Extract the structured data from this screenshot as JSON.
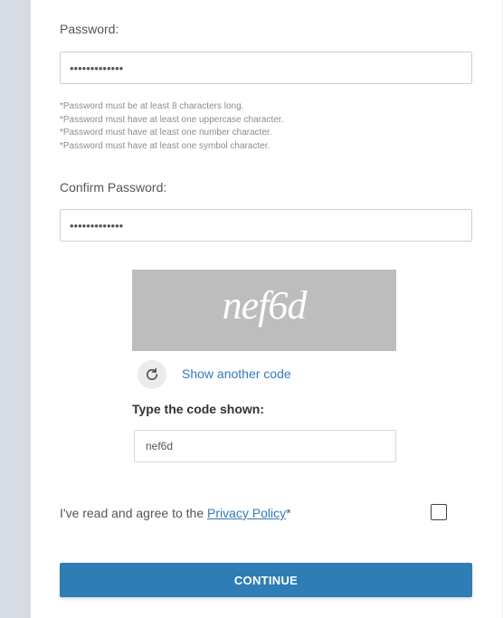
{
  "password": {
    "label": "Password:",
    "value": "•••••••••••••"
  },
  "password_rules": [
    "*Password must be at least 8 characters long.",
    "*Password must have at least one uppercase character.",
    "*Password must have at least one number character.",
    "*Password must have at least one symbol character."
  ],
  "confirm_password": {
    "label": "Confirm Password:",
    "value": "•••••••••••••"
  },
  "captcha": {
    "image_text": "nef6d",
    "refresh_icon": "refresh-icon",
    "another_code_label": "Show another code",
    "type_label": "Type the code shown:",
    "input_value": "nef6d"
  },
  "agreement": {
    "prefix": "I've read and agree to the ",
    "link_text": "Privacy Policy",
    "required_mark": "*"
  },
  "continue_button": {
    "label": "CONTINUE"
  },
  "colors": {
    "accent": "#2e7db4",
    "link": "#337ab7",
    "sidebar": "#d7dbe3"
  }
}
